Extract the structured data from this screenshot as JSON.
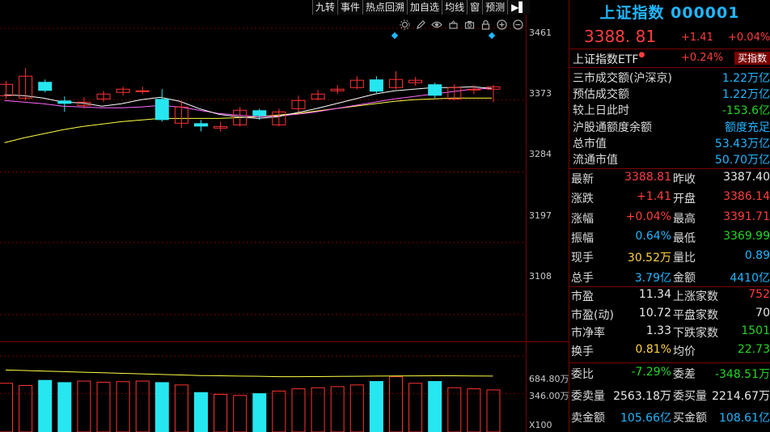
{
  "toolbar": {
    "items": [
      "九转",
      "事件",
      "热点回溯",
      "加自选",
      "均线",
      "窗",
      "预测"
    ],
    "exit_glyph": "▶▌"
  },
  "chart_icons": [
    "gear-icon",
    "pen-icon",
    "eye-icon",
    "basket-icon",
    "camera-icon",
    "lock-icon",
    "plus-icon",
    "minus-icon"
  ],
  "chart": {
    "y_ticks": [
      "3461",
      "3373",
      "3284",
      "3197",
      "3108"
    ],
    "vol_ticks": [
      "684.80万",
      "346.00万"
    ],
    "vol_multiplier": "X100",
    "colors": {
      "up": "#ff3232",
      "down": "#26e6f0",
      "ma5": "#ffffff",
      "ma10": "#ff66ff",
      "ma20": "#ffff44",
      "grid": "#7a0000"
    }
  },
  "chart_data": {
    "type": "candlestick",
    "ylim": [
      3080,
      3480
    ],
    "candles": [
      {
        "o": 3378,
        "c": 3392,
        "h": 3396,
        "l": 3374
      },
      {
        "o": 3375,
        "c": 3402,
        "h": 3412,
        "l": 3372
      },
      {
        "o": 3395,
        "c": 3384,
        "h": 3398,
        "l": 3382
      },
      {
        "o": 3372,
        "c": 3368,
        "h": 3377,
        "l": 3358
      },
      {
        "o": 3366,
        "c": 3370,
        "h": 3376,
        "l": 3362
      },
      {
        "o": 3374,
        "c": 3380,
        "h": 3384,
        "l": 3370
      },
      {
        "o": 3382,
        "c": 3386,
        "h": 3389,
        "l": 3378
      },
      {
        "o": 3384,
        "c": 3384,
        "h": 3389,
        "l": 3380
      },
      {
        "o": 3374,
        "c": 3348,
        "h": 3386,
        "l": 3346
      },
      {
        "o": 3344,
        "c": 3364,
        "h": 3372,
        "l": 3338
      },
      {
        "o": 3344,
        "c": 3340,
        "h": 3348,
        "l": 3334
      },
      {
        "o": 3338,
        "c": 3340,
        "h": 3346,
        "l": 3334
      },
      {
        "o": 3342,
        "c": 3360,
        "h": 3364,
        "l": 3340
      },
      {
        "o": 3360,
        "c": 3353,
        "h": 3362,
        "l": 3348
      },
      {
        "o": 3342,
        "c": 3358,
        "h": 3362,
        "l": 3340
      },
      {
        "o": 3362,
        "c": 3372,
        "h": 3378,
        "l": 3358
      },
      {
        "o": 3374,
        "c": 3380,
        "h": 3385,
        "l": 3372
      },
      {
        "o": 3384,
        "c": 3386,
        "h": 3391,
        "l": 3380
      },
      {
        "o": 3388,
        "c": 3397,
        "h": 3402,
        "l": 3386
      },
      {
        "o": 3398,
        "c": 3383,
        "h": 3402,
        "l": 3380
      },
      {
        "o": 3388,
        "c": 3398,
        "h": 3408,
        "l": 3386
      },
      {
        "o": 3394,
        "c": 3397,
        "h": 3401,
        "l": 3390
      },
      {
        "o": 3392,
        "c": 3378,
        "h": 3394,
        "l": 3375
      },
      {
        "o": 3374,
        "c": 3388,
        "h": 3392,
        "l": 3372
      },
      {
        "o": 3386,
        "c": 3386,
        "h": 3391,
        "l": 3380
      },
      {
        "o": 3386,
        "c": 3389,
        "h": 3391,
        "l": 3370
      }
    ],
    "ma5": [
      3379,
      3378,
      3375,
      3370,
      3369,
      3365,
      3368,
      3373,
      3376,
      3371,
      3362,
      3355,
      3352,
      3350,
      3352,
      3357,
      3362,
      3368,
      3374,
      3380,
      3384,
      3386,
      3388,
      3388,
      3389,
      3387
    ],
    "ma10": [
      3372,
      3370,
      3368,
      3365,
      3364,
      3363,
      3363,
      3364,
      3366,
      3364,
      3360,
      3356,
      3354,
      3352,
      3353,
      3355,
      3358,
      3362,
      3366,
      3370,
      3374,
      3377,
      3380,
      3383,
      3386,
      3387
    ],
    "ma20": [
      3320,
      3326,
      3331,
      3336,
      3340,
      3343,
      3346,
      3348,
      3350,
      3350,
      3350,
      3350,
      3351,
      3352,
      3354,
      3356,
      3359,
      3362,
      3365,
      3368,
      3371,
      3373,
      3374,
      3375,
      3375,
      3375
    ],
    "volumes": [
      440,
      420,
      470,
      450,
      460,
      450,
      455,
      460,
      450,
      425,
      360,
      340,
      330,
      350,
      370,
      390,
      400,
      410,
      425,
      460,
      500,
      440,
      460,
      400,
      390,
      380
    ],
    "vol_ma": [
      560,
      555,
      550,
      545,
      540,
      535,
      530,
      525,
      520,
      515,
      510,
      508,
      505,
      503,
      500,
      500,
      501,
      502,
      503,
      505,
      506,
      507,
      508,
      508,
      506,
      505
    ],
    "vol_ylim": [
      0,
      760
    ]
  },
  "panel": {
    "title": "上证指数 000001",
    "price": "3388. 81",
    "change": "+1.41",
    "change_pct": "+0.04%",
    "etf_label": "上证指数ETF",
    "etf_pct": "+0.24%",
    "buy_button": "买指数",
    "stats": [
      {
        "label": "三市成交额(沪深京)",
        "value": "1.22万亿",
        "color": "cyan"
      },
      {
        "label": "预估成交额",
        "value": "1.22万亿",
        "color": "cyan"
      },
      {
        "label": "较上日此时",
        "value": "-153.6亿",
        "color": "green"
      },
      {
        "label": "沪股通额度余额",
        "value": "额度充足",
        "color": "cyan"
      },
      {
        "label": "总市值",
        "value": "53.43万亿",
        "color": "cyan"
      },
      {
        "label": "流通市值",
        "value": "50.70万亿",
        "color": "cyan"
      }
    ],
    "quote_rows": [
      {
        "l1": "最新",
        "v1": "3388.81",
        "c1": "red",
        "l2": "昨收",
        "v2": "3387.40",
        "c2": "white"
      },
      {
        "l1": "涨跌",
        "v1": "+1.41",
        "c1": "red",
        "l2": "开盘",
        "v2": "3386.14",
        "c2": "red"
      },
      {
        "l1": "涨幅",
        "v1": "+0.04%",
        "c1": "red",
        "l2": "最高",
        "v2": "3391.71",
        "c2": "red"
      },
      {
        "l1": "振幅",
        "v1": "0.64%",
        "c1": "cyan",
        "l2": "最低",
        "v2": "3369.99",
        "c2": "green"
      },
      {
        "l1": "现手",
        "v1": "30.52万",
        "c1": "yellow",
        "l2": "量比",
        "v2": "0.89",
        "c2": "cyan"
      },
      {
        "l1": "总手",
        "v1": "3.79亿",
        "c1": "cyan",
        "l2": "金额",
        "v2": "4410亿",
        "c2": "cyan"
      }
    ],
    "breadth_rows": [
      {
        "l1": "市盈",
        "v1": "11.34",
        "c1": "white",
        "l2": "上涨家数",
        "v2": "752",
        "c2": "red"
      },
      {
        "l1": "市盈(动)",
        "v1": "10.72",
        "c1": "white",
        "l2": "平盘家数",
        "v2": "70",
        "c2": "white"
      },
      {
        "l1": "市净率",
        "v1": "1.33",
        "c1": "white",
        "l2": "下跌家数",
        "v2": "1501",
        "c2": "green"
      },
      {
        "l1": "换手",
        "v1": "0.81%",
        "c1": "yellow",
        "l2": "均价",
        "v2": "22.73",
        "c2": "green"
      }
    ],
    "order_rows": [
      {
        "l1": "委比",
        "v1": "-7.29%",
        "c1": "green",
        "l2": "委差",
        "v2": "-348.51万",
        "c2": "green"
      },
      {
        "l1": "委卖量",
        "v1": "2563.18万",
        "c1": "white",
        "l2": "委买量",
        "v2": "2214.67万",
        "c2": "white"
      },
      {
        "l1": "卖金额",
        "v1": "105.66亿",
        "c1": "cyan",
        "l2": "买金额",
        "v2": "108.61亿",
        "c2": "cyan"
      }
    ]
  }
}
